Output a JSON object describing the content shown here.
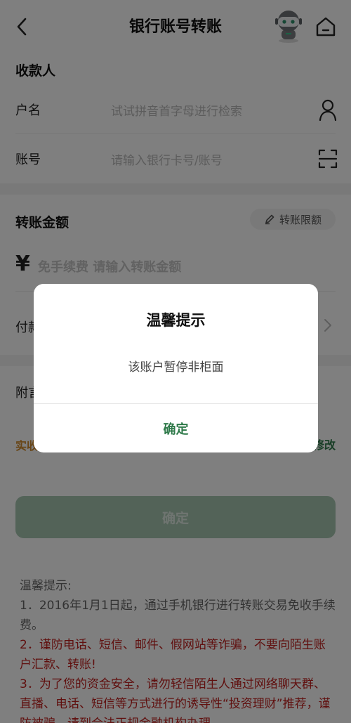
{
  "header": {
    "title": "银行账号转账",
    "back_icon": "chevron-left-icon",
    "robot_icon": "robot-assistant-icon",
    "home_icon": "home-icon"
  },
  "payee": {
    "section_title": "收款人",
    "name_label": "户名",
    "name_placeholder": "试试拼音首字母进行检索",
    "account_label": "账号",
    "account_placeholder": "请输入银行卡号/账号"
  },
  "amount": {
    "section_title": "转账金额",
    "limit_button": "转账限额",
    "currency_symbol": "¥",
    "placeholder": "免手续费 请输入转账金额"
  },
  "pay": {
    "label": "付款"
  },
  "note": {
    "label": "附言"
  },
  "real": {
    "left_text": "实收",
    "modify": "修改"
  },
  "confirm_button": "确定",
  "tips": {
    "title": "温馨提示:",
    "item1": "1．2016年1月1日起，通过手机银行进行转账交易免收手续费。",
    "item2": "2．谨防电话、短信、邮件、假网站等诈骗，不要向陌生账户汇款、转账!",
    "item3": "3．为了您的资金安全，请勿轻信陌生人通过网络聊天群、直播、电话、短信等方式进行的诱导性“投资理财”推荐，谨防被骗，请到合法正规金融机构办理"
  },
  "dialog": {
    "title": "温馨提示",
    "message": "该账户暂停非柜面",
    "ok": "确定"
  },
  "colors": {
    "brand_green": "#2f7a4a",
    "disabled_green": "#a7c6b0",
    "warning_red": "#c0201f",
    "accent_orange": "#d08a2c"
  }
}
